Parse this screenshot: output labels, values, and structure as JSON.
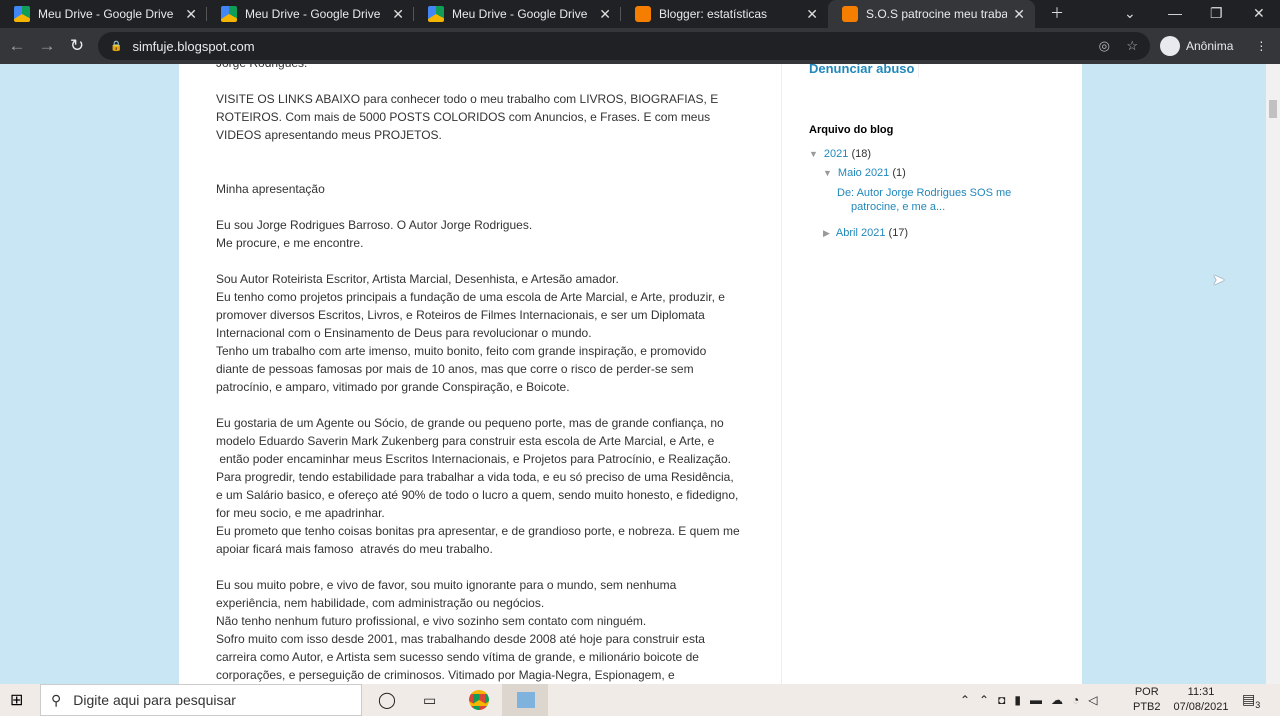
{
  "browser": {
    "tabs": [
      {
        "title": "Meu Drive - Google Drive",
        "icon": "google-drive-icon"
      },
      {
        "title": "Meu Drive - Google Drive",
        "icon": "google-drive-icon"
      },
      {
        "title": "Meu Drive - Google Drive",
        "icon": "google-drive-icon"
      },
      {
        "title": "Blogger: estatísticas",
        "icon": "blogger-icon"
      },
      {
        "title": "S.O.S patrocine meu trabalho",
        "icon": "blogger-icon",
        "active": true
      }
    ],
    "url": "simfuje.blogspot.com",
    "profile": "Anônima"
  },
  "post": {
    "paragraphs": [
      [
        "Jorge Rodrigues."
      ],
      [
        "VISITE OS LINKS ABAIXO para conhecer todo o meu trabalho com LIVROS, BIOGRAFIAS, E",
        "ROTEIROS. Com mais de 5000 POSTS COLORIDOS com Anuncios, e Frases. E com meus",
        "VIDEOS apresentando meus PROJETOS."
      ],
      [
        "Minha apresentação"
      ],
      [
        "Eu sou Jorge Rodrigues Barroso. O Autor Jorge Rodrigues.",
        "Me procure, e me encontre."
      ],
      [
        "Sou Autor Roteirista Escritor, Artista Marcial, Desenhista, e Artesão amador.",
        "Eu tenho como projetos principais a fundação de uma escola de Arte Marcial, e Arte, produzir, e",
        "promover diversos Escritos, Livros, e Roteiros de Filmes Internacionais, e ser um Diplomata",
        "Internacional com o Ensinamento de Deus para revolucionar o mundo.",
        "Tenho um trabalho com arte imenso, muito bonito, feito com grande inspiração, e promovido",
        "diante de pessoas famosas por mais de 10 anos, mas que corre o risco de perder-se sem",
        "patrocínio, e amparo, vitimado por grande Conspiração, e Boicote."
      ],
      [
        "Eu gostaria de um Agente ou Sócio, de grande ou pequeno porte, mas de grande confiança, no",
        "modelo Eduardo Saverin Mark Zukenberg para construir esta escola de Arte Marcial, e Arte, e",
        " então poder encaminhar meus Escritos Internacionais, e Projetos para Patrocínio, e Realização.",
        "Para progredir, tendo estabilidade para trabalhar a vida toda, e eu só preciso de uma Residência,",
        "e um Salário basico, e ofereço até 90% de todo o lucro a quem, sendo muito honesto, e fidedigno,",
        "for meu socio, e me apadrinhar.",
        "Eu prometo que tenho coisas bonitas pra apresentar, e de grandioso porte, e nobreza. E quem me",
        "apoiar ficará mais famoso  através do meu trabalho."
      ],
      [
        "Eu sou muito pobre, e vivo de favor, sou muito ignorante para o mundo, sem nenhuma",
        "experiência, nem habilidade, com administração ou negócios.",
        "Não tenho nenhum futuro profissional, e vivo sozinho sem contato com ninguém.",
        "Sofro muito com isso desde 2001, mas trabalhando desde 2008 até hoje para construir esta",
        "carreira como Autor, e Artista sem sucesso sendo vítima de grande, e milionário boicote de",
        "corporações, e perseguição de criminosos. Vitimado por Magia-Negra, Espionagem, e"
      ]
    ]
  },
  "sidebar": {
    "report_link": "Denunciar abuso",
    "archive_title": "Arquivo do blog",
    "year": "2021",
    "year_count": "(18)",
    "month1": "Maio 2021",
    "month1_count": "(1)",
    "post_link_1": "De: Autor Jorge Rodrigues SOS me",
    "post_link_2": "patrocine, e me a...",
    "month2": "Abril 2021",
    "month2_count": "(17)"
  },
  "taskbar": {
    "search_placeholder": "Digite aqui para pesquisar",
    "lang1": "POR",
    "lang2": "PTB2",
    "time": "11:31",
    "date": "07/08/2021",
    "notifications": "3"
  }
}
